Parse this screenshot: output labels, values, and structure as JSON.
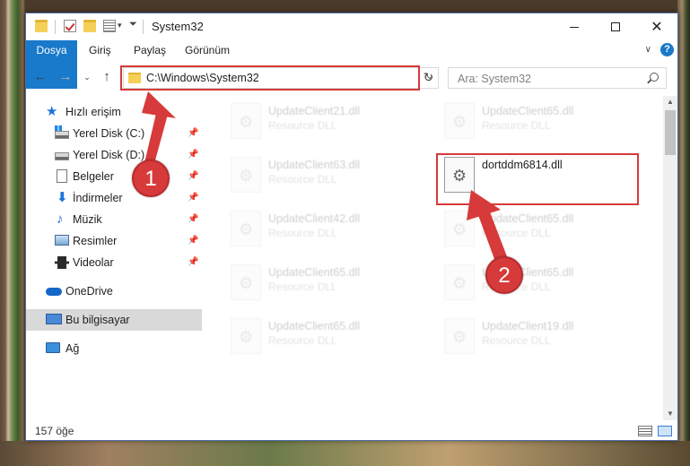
{
  "window": {
    "title": "System32",
    "ribbon_tabs": [
      "Dosya",
      "Giriş",
      "Paylaş",
      "Görünüm"
    ],
    "accent": "#1979ca"
  },
  "navbar": {
    "address": "C:\\Windows\\System32",
    "search_placeholder": "Ara: System32"
  },
  "sidebar": {
    "items": [
      {
        "label": "Hızlı erişim",
        "icon": "star-icon",
        "pinned": false
      },
      {
        "label": "Yerel Disk (C:)",
        "icon": "disk-icon",
        "pinned": true
      },
      {
        "label": "Yerel Disk (D:)",
        "icon": "disk-icon",
        "pinned": true
      },
      {
        "label": "Belgeler",
        "icon": "document-icon",
        "pinned": true
      },
      {
        "label": "İndirmeler",
        "icon": "download-icon",
        "pinned": true
      },
      {
        "label": "Müzik",
        "icon": "music-icon",
        "pinned": true
      },
      {
        "label": "Resimler",
        "icon": "pictures-icon",
        "pinned": true
      },
      {
        "label": "Videolar",
        "icon": "video-icon",
        "pinned": true
      },
      {
        "label": "OneDrive",
        "icon": "cloud-icon",
        "pinned": false
      },
      {
        "label": "Bu bilgisayar",
        "icon": "computer-icon",
        "pinned": false,
        "selected": true
      },
      {
        "label": "Ağ",
        "icon": "network-icon",
        "pinned": false
      }
    ]
  },
  "files": [
    {
      "name": "UpdateClient21.dll",
      "type": "Resource DLL",
      "faded": true
    },
    {
      "name": "UpdateClient65.dll",
      "type": "Resource DLL",
      "faded": true
    },
    {
      "name": "UpdateClient63.dll",
      "type": "Resource DLL",
      "faded": true
    },
    {
      "name": "dortddm6814.dll",
      "type": "",
      "faded": false
    },
    {
      "name": "UpdateClient42.dll",
      "type": "Resource DLL",
      "faded": true
    },
    {
      "name": "UpdateClient65.dll",
      "type": "Resource DLL",
      "faded": true
    },
    {
      "name": "UpdateClient65.dll",
      "type": "Resource DLL",
      "faded": true
    },
    {
      "name": "UpdateClient65.dll",
      "type": "Resource DLL",
      "faded": true
    },
    {
      "name": "UpdateClient65.dll",
      "type": "Resource DLL",
      "faded": true
    },
    {
      "name": "UpdateClient19.dll",
      "type": "Resource DLL",
      "faded": true
    }
  ],
  "status": {
    "item_count": "157 öğe"
  },
  "annotations": {
    "badge1": "1",
    "badge2": "2",
    "color": "#d73a3a"
  }
}
